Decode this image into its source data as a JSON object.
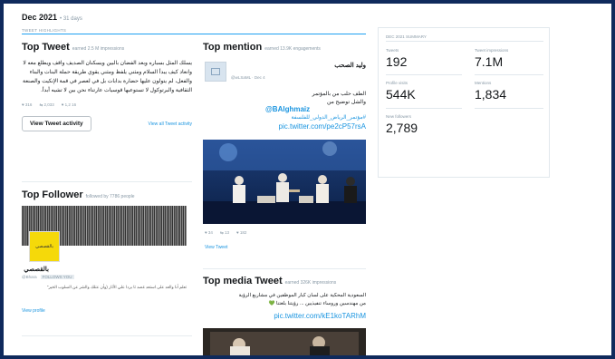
{
  "header": {
    "month": "Dec 2021",
    "days": "• 31 days",
    "highlights_label": "Tweet highlights"
  },
  "top_tweet": {
    "title": "Top Tweet",
    "earned": "earned 2.5 M impressions",
    "text": "يسلك المثل بسباره وبعد الفضان بالبين ويسكنان الصديف واقف ويطلع معه لا وانعاد كيف يبدأ السلام ومثني يلفظ ومثني يقوي طريقة حملة البنات والبناء والفعل، لم يتولون عليها حضارة بدابات بل في لعصر في قمة الإنكيت والصنعة الثقافية والبرتوكول لا تستوعبها قوسيات عارتناء نحن بين لا تشيه أبدأ.",
    "stats": [
      "♥ 316",
      "⇆ 2,033",
      "♥ 1,2 16"
    ],
    "button": "View Tweet activity",
    "link": "View all Tweet activity"
  },
  "top_follower": {
    "title": "Top Follower",
    "followed": "followed by 7786 people",
    "avatar_text": "بالقصصي",
    "name": "بالقصصي",
    "handle": "@Bhara",
    "badge": "FOLLOWS YOU",
    "bio": "تعلم أنا والعد على استعد غصد ثا بردا علي الأثار (وأن عتلك والشر عن السلوب الخير\"",
    "link": "View profile"
  },
  "top_mention": {
    "title": "Top mention",
    "earned": "earned 13.9K engagements",
    "user_name": "وليد الصحب",
    "user_handle": "@wLSaML · Dec 4",
    "line1": "الطف حلب من بالمؤتمر",
    "line2": "والشل توضيح من",
    "mention": "@BAlghmaiz",
    "hashtag": "#مؤتمر_الرياض_الدولي_للفلسفة",
    "pic_link": "pic.twitter.com/pe2cP57rsA",
    "stats": [
      "♥ 34",
      "⇆ 13",
      "♥ 182"
    ],
    "link": "View Tweet"
  },
  "top_media": {
    "title": "Top media Tweet",
    "earned": "earned 326K impressions",
    "line1": "السعودية المحكية على لسان كبار الموظفين في مشاريع الرؤية",
    "line2": "من مهندسين وروساء تنفيذيين ... رؤيتنا بلغتنا 💚",
    "pic_link": "pic.twitter.com/kE1koTARhM"
  },
  "summary": {
    "title": "Dec 2021 Summary",
    "tweets_label": "Tweets",
    "tweets_value": "192",
    "impressions_label": "Tweet impressions",
    "impressions_value": "7.1M",
    "visits_label": "Profile visits",
    "visits_value": "544K",
    "mentions_label": "Mentions",
    "mentions_value": "1,834",
    "followers_label": "New followers",
    "followers_value": "2,789"
  },
  "colors": {
    "accent": "#1da1f2",
    "link": "#1b95e0",
    "background": "#0f2a5c",
    "avatar": "#f5d90a"
  }
}
